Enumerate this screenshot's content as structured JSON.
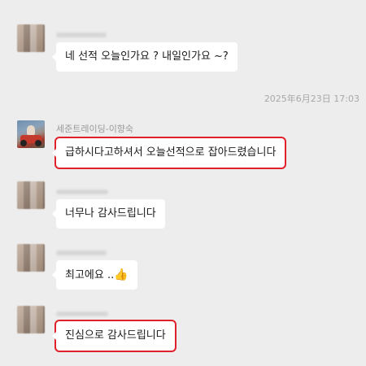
{
  "messages": [
    {
      "text": "네 선적 오늘인가요 ? 내일인가요 ~?"
    },
    {
      "sender": "세준트레이딩-이향숙",
      "text": "급하시다고하셔서  오늘선적으로 잡아드렸습니다"
    },
    {
      "text": "너무나 감사드립니다"
    },
    {
      "text": "최고에요 ..",
      "emoji": "👍"
    },
    {
      "text": "진심으로 감사드립니다"
    }
  ],
  "timestamp": "2025年6月23日 17:03",
  "colors": {
    "background": "#ededed",
    "bubble": "#ffffff",
    "highlight": "#e0212b"
  }
}
